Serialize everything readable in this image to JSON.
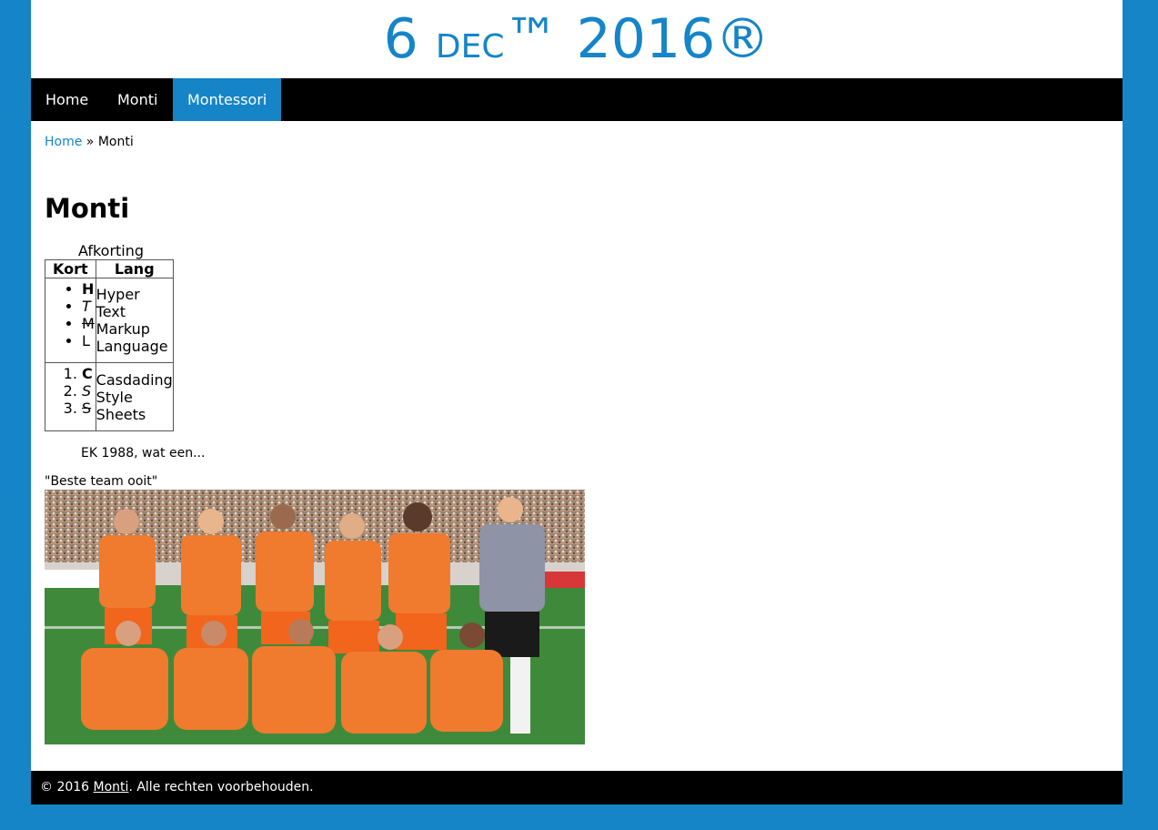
{
  "header": {
    "title_main": "6 ",
    "title_small": "DEC",
    "title_tail": "™ 2016®"
  },
  "nav": {
    "items": [
      {
        "label": "Home"
      },
      {
        "label": "Monti"
      },
      {
        "label": "Montessori"
      }
    ],
    "active_label": "Montessori"
  },
  "breadcrumb": {
    "home": "Home",
    "sep": " » ",
    "current": "Monti"
  },
  "page": {
    "heading": "Monti"
  },
  "table": {
    "caption": "Afkorting",
    "headers": [
      "Kort",
      "Lang"
    ],
    "rows": [
      {
        "short": [
          "H",
          "T",
          "M",
          "L"
        ],
        "long": [
          "Hyper",
          "Text",
          "Markup",
          "Language"
        ]
      },
      {
        "short": [
          "C",
          "S",
          "S"
        ],
        "long": [
          "Casdading",
          "Style",
          "Sheets"
        ]
      }
    ]
  },
  "intro": "EK 1988, wat een...",
  "image": {
    "caption": "\"Beste team ooit\""
  },
  "footer": {
    "prefix": "© 2016 ",
    "link": "Monti",
    "suffix": ". Alle rechten voorbehouden."
  },
  "colors": {
    "accent": "#1585c8",
    "nav_bg": "#000000",
    "jersey": "#f07a2e",
    "pitch": "#3f8a3a"
  }
}
